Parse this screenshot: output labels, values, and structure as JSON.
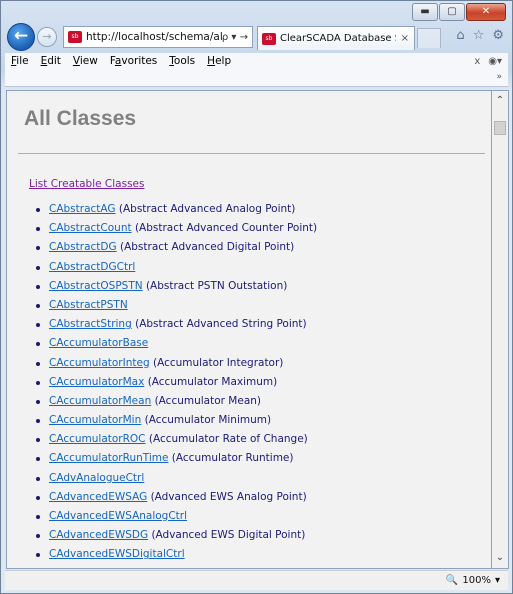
{
  "browser": {
    "url": "http://localhost/schema/all",
    "address_tools": "ρ ▾ →",
    "tab_title": "ClearSCADA Database Sche...",
    "tab_close": "×",
    "site_icon_text": "sb",
    "caption": {
      "minimize": "▬",
      "maximize": "▢",
      "close": "✕"
    },
    "right_icons": [
      "home-icon",
      "star-icon",
      "gear-icon"
    ]
  },
  "menubar": {
    "items": [
      {
        "key": "F",
        "rest": "ile"
      },
      {
        "key": "E",
        "rest": "dit"
      },
      {
        "key": "V",
        "rest": "iew"
      },
      {
        "key": "a",
        "prefix": "F",
        "rest": "vorites"
      },
      {
        "key": "T",
        "rest": "ools"
      },
      {
        "key": "H",
        "rest": "elp"
      }
    ],
    "right_close": "x"
  },
  "page": {
    "heading": "All Classes",
    "creatable_link": "List Creatable Classes",
    "classes": [
      {
        "name": "CAbstractAG",
        "desc": "(Abstract Advanced Analog Point)"
      },
      {
        "name": "CAbstractCount",
        "desc": "(Abstract Advanced Counter Point)"
      },
      {
        "name": "CAbstractDG",
        "desc": "(Abstract Advanced Digital Point)"
      },
      {
        "name": "CAbstractDGCtrl",
        "desc": ""
      },
      {
        "name": "CAbstractOSPSTN",
        "desc": "(Abstract PSTN Outstation)"
      },
      {
        "name": "CAbstractPSTN",
        "desc": ""
      },
      {
        "name": "CAbstractString",
        "desc": "(Abstract Advanced String Point)"
      },
      {
        "name": "CAccumulatorBase",
        "desc": ""
      },
      {
        "name": "CAccumulatorInteg",
        "desc": "(Accumulator Integrator)"
      },
      {
        "name": "CAccumulatorMax",
        "desc": "(Accumulator Maximum)"
      },
      {
        "name": "CAccumulatorMean",
        "desc": "(Accumulator Mean)"
      },
      {
        "name": "CAccumulatorMin",
        "desc": "(Accumulator Minimum)"
      },
      {
        "name": "CAccumulatorROC",
        "desc": "(Accumulator Rate of Change)"
      },
      {
        "name": "CAccumulatorRunTime",
        "desc": "(Accumulator Runtime)"
      },
      {
        "name": "CAdvAnalogueCtrl",
        "desc": ""
      },
      {
        "name": "CAdvancedEWSAG",
        "desc": "(Advanced EWS Analog Point)"
      },
      {
        "name": "CAdvancedEWSAnalogCtrl",
        "desc": ""
      },
      {
        "name": "CAdvancedEWSDG",
        "desc": "(Advanced EWS Digital Point)"
      },
      {
        "name": "CAdvancedEWSDigitalCtrl",
        "desc": ""
      }
    ]
  },
  "status": {
    "zoom": "100%",
    "zoom_arrow": "▾"
  }
}
